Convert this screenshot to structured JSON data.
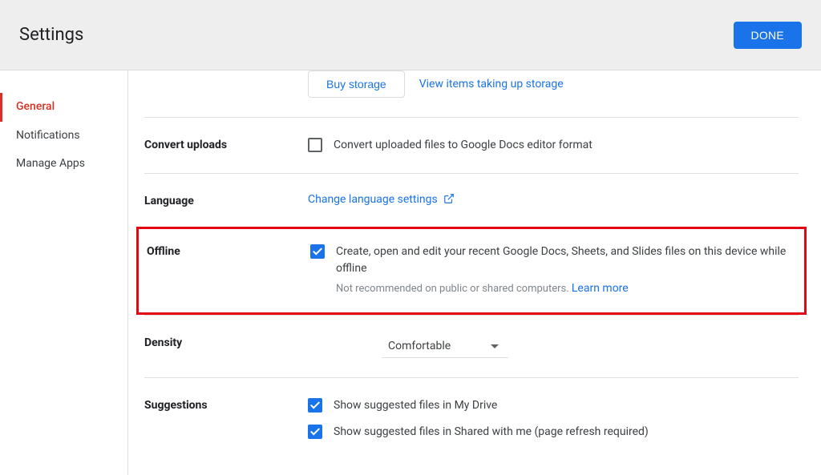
{
  "header": {
    "title": "Settings",
    "done_label": "DONE"
  },
  "sidebar": {
    "items": [
      {
        "label": "General",
        "active": true
      },
      {
        "label": "Notifications",
        "active": false
      },
      {
        "label": "Manage Apps",
        "active": false
      }
    ]
  },
  "storage": {
    "buy_label": "Buy storage",
    "view_label": "View items taking up storage"
  },
  "sections": {
    "convert": {
      "label": "Convert uploads",
      "checkbox_label": "Convert uploaded files to Google Docs editor format",
      "checked": false
    },
    "language": {
      "label": "Language",
      "link": "Change language settings"
    },
    "offline": {
      "label": "Offline",
      "checkbox_label": "Create, open and edit your recent Google Docs, Sheets, and Slides files on this device while offline",
      "subtext": "Not recommended on public or shared computers.",
      "learn_more": "Learn more",
      "checked": true
    },
    "density": {
      "label": "Density",
      "value": "Comfortable"
    },
    "suggestions": {
      "label": "Suggestions",
      "items": [
        {
          "label": "Show suggested files in My Drive",
          "checked": true
        },
        {
          "label": "Show suggested files in Shared with me (page refresh required)",
          "checked": true
        }
      ]
    }
  }
}
